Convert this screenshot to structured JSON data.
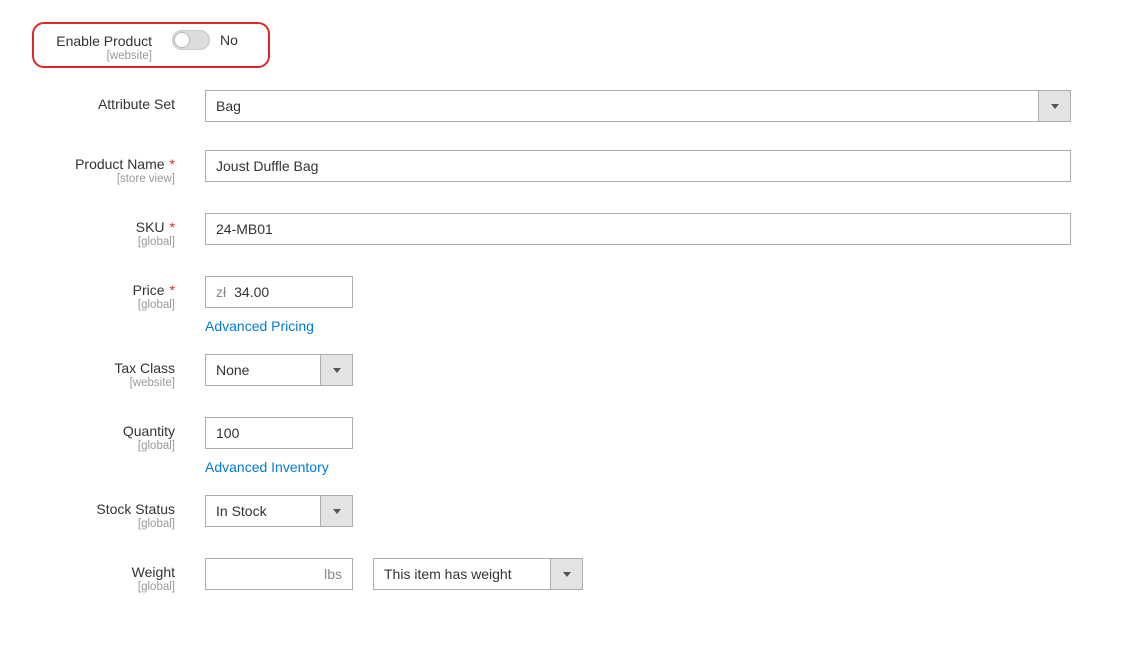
{
  "enable": {
    "label": "Enable Product",
    "scope": "[website]",
    "value_text": "No"
  },
  "attributeSet": {
    "label": "Attribute Set",
    "value": "Bag"
  },
  "productName": {
    "label": "Product Name",
    "scope": "[store view]",
    "value": "Joust Duffle Bag"
  },
  "sku": {
    "label": "SKU",
    "scope": "[global]",
    "value": "24-MB01"
  },
  "price": {
    "label": "Price",
    "scope": "[global]",
    "currency": "zł",
    "value": "34.00",
    "advanced_link": "Advanced Pricing"
  },
  "taxClass": {
    "label": "Tax Class",
    "scope": "[website]",
    "value": "None"
  },
  "quantity": {
    "label": "Quantity",
    "scope": "[global]",
    "value": "100",
    "advanced_link": "Advanced Inventory"
  },
  "stockStatus": {
    "label": "Stock Status",
    "scope": "[global]",
    "value": "In Stock"
  },
  "weight": {
    "label": "Weight",
    "scope": "[global]",
    "value": "",
    "unit": "lbs",
    "has_weight": "This item has weight"
  }
}
